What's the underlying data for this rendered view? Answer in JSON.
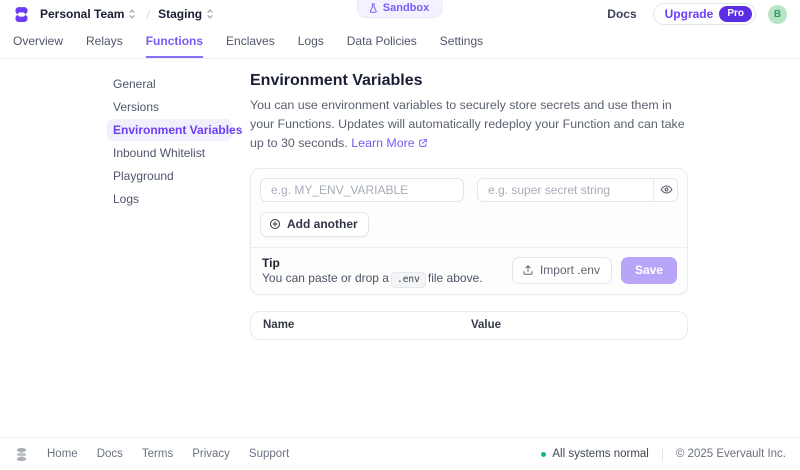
{
  "header": {
    "team_name": "Personal Team",
    "environment_name": "Staging",
    "sandbox_label": "Sandbox",
    "docs_label": "Docs",
    "upgrade_label": "Upgrade",
    "pro_label": "Pro",
    "avatar_initial": "B",
    "tabs": [
      "Overview",
      "Relays",
      "Functions",
      "Enclaves",
      "Logs",
      "Data Policies",
      "Settings"
    ],
    "active_tab": "Functions"
  },
  "sidebar": {
    "items": [
      "General",
      "Versions",
      "Environment Variables",
      "Inbound Whitelist",
      "Playground",
      "Logs"
    ],
    "active_item": "Environment Variables"
  },
  "main": {
    "title": "Environment Variables",
    "description": "You can use environment variables to securely store secrets and use them in your Functions. Updates will automatically redeploy your Function and can take up to 30 seconds.",
    "learn_more_label": "Learn More",
    "editor": {
      "name_placeholder": "e.g. MY_ENV_VARIABLE",
      "value_placeholder": "e.g. super secret string",
      "add_button_label": "Add another",
      "tip_title": "Tip",
      "tip_before": "You can paste or drop a",
      "tip_code": ".env",
      "tip_after": "file above.",
      "import_button_label": "Import .env",
      "save_button_label": "Save"
    },
    "table": {
      "headers": [
        "Name",
        "Value"
      ],
      "rows": []
    }
  },
  "footer": {
    "links": [
      "Home",
      "Docs",
      "Terms",
      "Privacy",
      "Support"
    ],
    "status_text": "All systems normal",
    "copyright": "© 2025 Evervault Inc."
  },
  "colors": {
    "accent_purple": "#7a5af8",
    "pro_badge_purple": "#5b2ee5",
    "save_disabled_purple": "#b8a5f8",
    "status_green": "#10b981",
    "avatar_green_bg": "#b7e4c7"
  }
}
